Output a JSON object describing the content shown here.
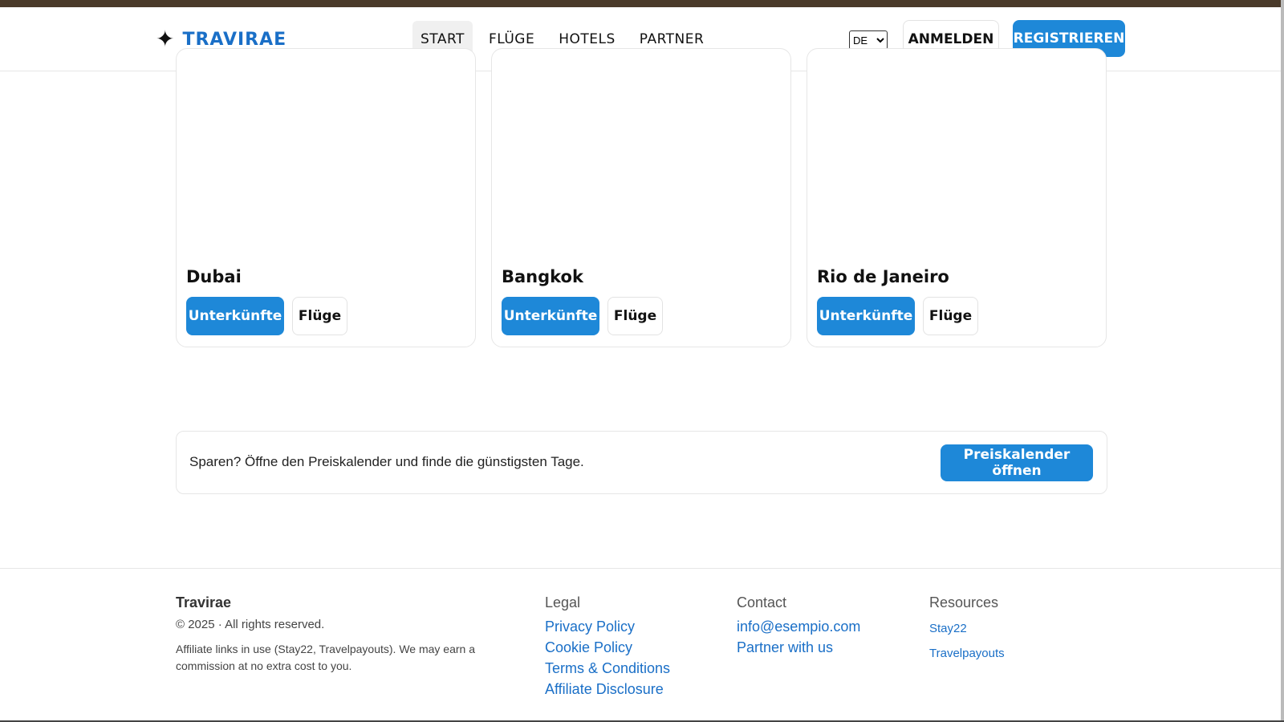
{
  "brand": {
    "name": "TRAVIRAE",
    "icon": "sparkle-star-icon"
  },
  "nav": [
    {
      "label": "START",
      "active": true
    },
    {
      "label": "FLÜGE"
    },
    {
      "label": "HOTELS"
    },
    {
      "label": "PARTNER"
    }
  ],
  "lang": {
    "selected": "DE"
  },
  "auth": {
    "login": "ANMELDEN",
    "register": "REGISTRIEREN"
  },
  "cards": [
    {
      "title": "Dubai",
      "btn_stay": "Unterkünfte",
      "btn_fly": "Flüge"
    },
    {
      "title": "Bangkok",
      "btn_stay": "Unterkünfte",
      "btn_fly": "Flüge"
    },
    {
      "title": "Rio de Janeiro",
      "btn_stay": "Unterkünfte",
      "btn_fly": "Flüge"
    }
  ],
  "promo": {
    "text": "Sparen? Öffne den Preiskalender und finde die günstigsten Tage.",
    "button": "Preiskalender öffnen"
  },
  "footer": {
    "brand": "Travirae",
    "copyright": "© 2025 · All rights reserved.",
    "affiliate_note": "Affiliate links in use (Stay22, Travelpayouts). We may earn a commission at no extra cost to you.",
    "legal": {
      "heading": "Legal",
      "links": [
        "Privacy Policy",
        "Cookie Policy",
        "Terms & Conditions",
        "Affiliate Disclosure"
      ]
    },
    "contact": {
      "heading": "Contact",
      "links": [
        "info@esempio.com",
        "Partner with us"
      ]
    },
    "resources": {
      "heading": "Resources",
      "links": [
        "Stay22",
        "Travelpayouts"
      ]
    }
  },
  "colors": {
    "accent": "#1e88d8",
    "link": "#1a6fc7",
    "topstrip": "#4a3a2a"
  }
}
